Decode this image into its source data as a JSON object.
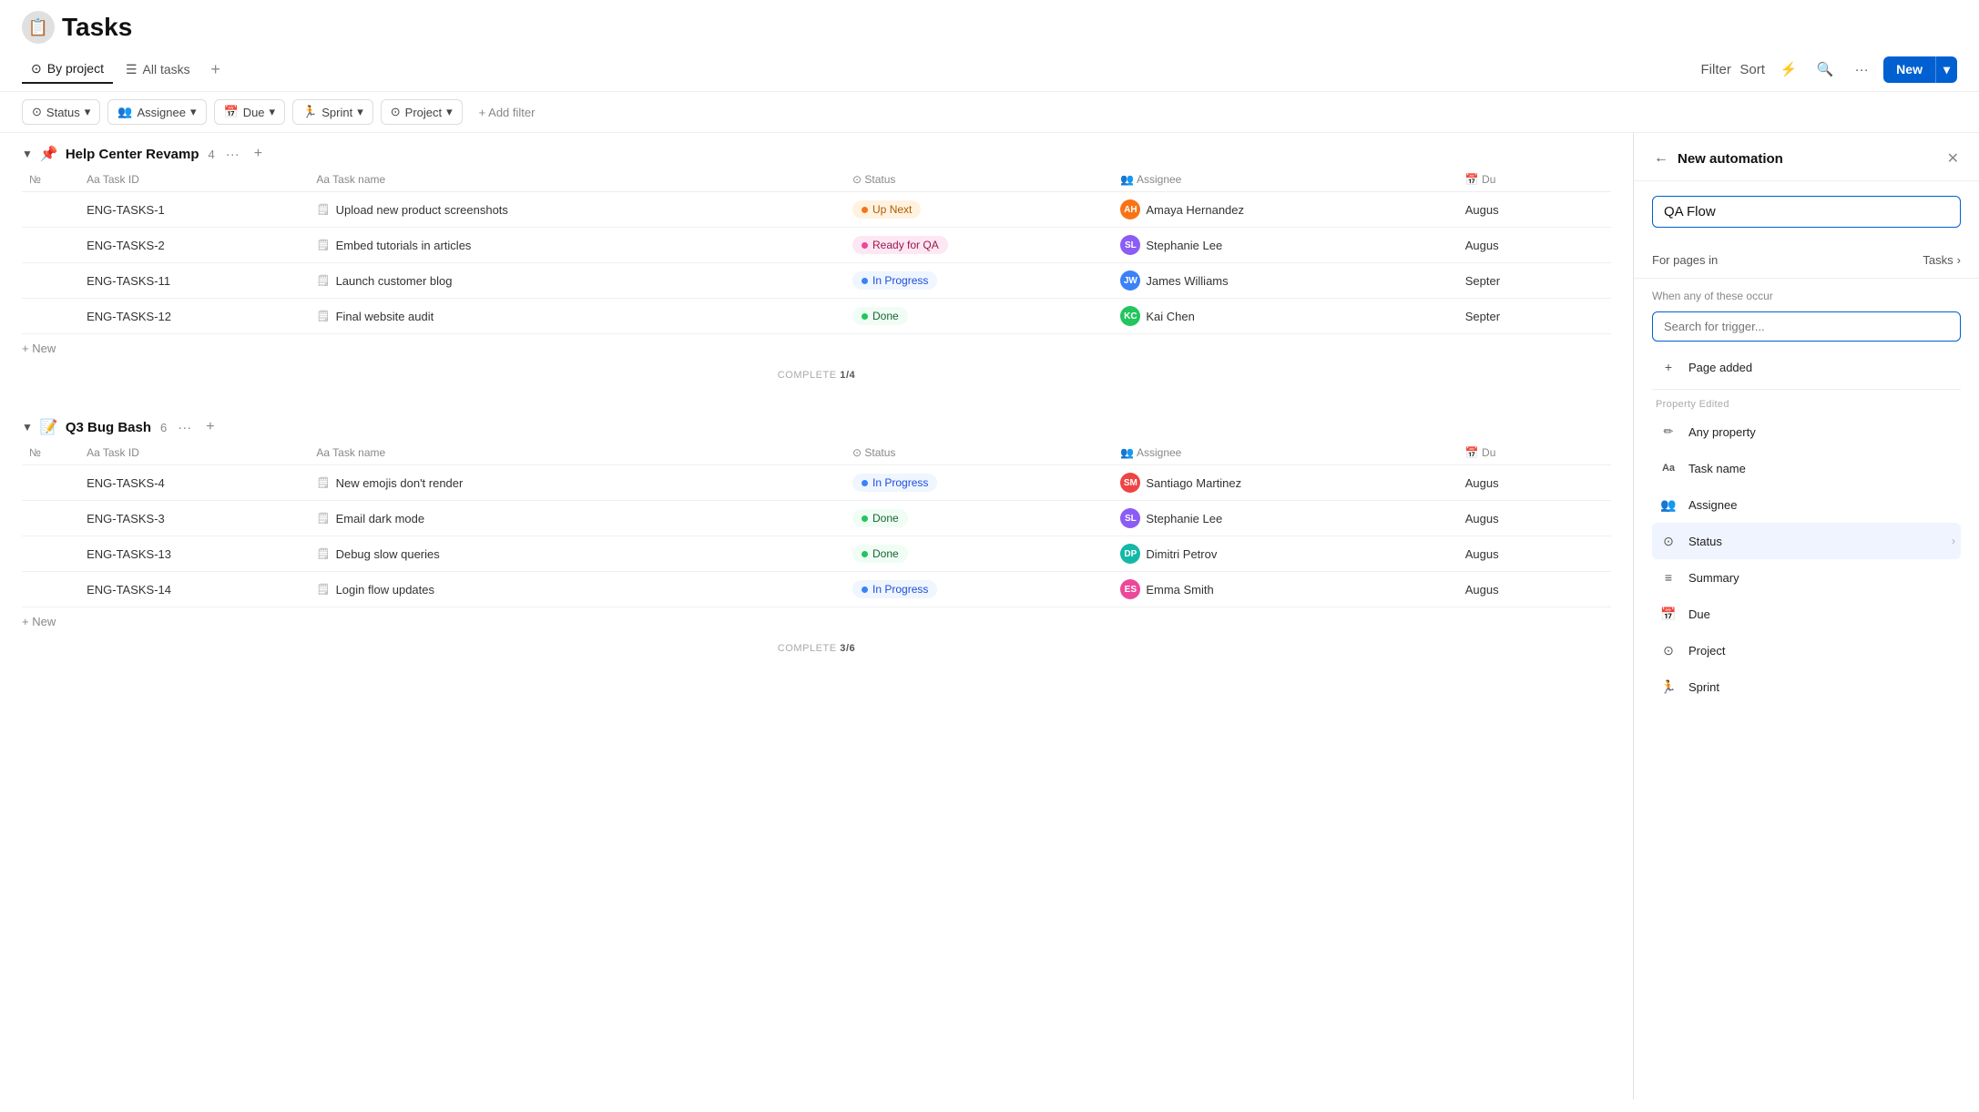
{
  "header": {
    "icon": "📋",
    "title": "Tasks"
  },
  "toolbar": {
    "views": [
      {
        "id": "by-project",
        "label": "By project",
        "icon": "⊙",
        "active": true
      },
      {
        "id": "all-tasks",
        "label": "All tasks",
        "icon": "☰",
        "active": false
      }
    ],
    "add_view_label": "+",
    "filter_label": "Filter",
    "sort_label": "Sort",
    "lightning_label": "⚡",
    "search_label": "🔍",
    "more_label": "···",
    "new_label": "New",
    "new_chevron": "▾"
  },
  "filters": [
    {
      "id": "status",
      "icon": "⊙",
      "label": "Status"
    },
    {
      "id": "assignee",
      "icon": "👥",
      "label": "Assignee"
    },
    {
      "id": "due",
      "icon": "📅",
      "label": "Due"
    },
    {
      "id": "sprint",
      "icon": "🏃",
      "label": "Sprint"
    },
    {
      "id": "project",
      "icon": "⊙",
      "label": "Project"
    }
  ],
  "add_filter_label": "+ Add filter",
  "columns": [
    {
      "id": "num",
      "label": "№"
    },
    {
      "id": "task_id",
      "label": "Task ID"
    },
    {
      "id": "task_name",
      "label": "Task name"
    },
    {
      "id": "status",
      "label": "Status"
    },
    {
      "id": "assignee",
      "label": "Assignee"
    },
    {
      "id": "due",
      "label": "Du"
    }
  ],
  "projects": [
    {
      "id": "help-center",
      "icon": "📌",
      "name": "Help Center Revamp",
      "count": 4,
      "complete": "1/4",
      "tasks": [
        {
          "id": "ENG-TASKS-1",
          "name": "Upload new product screenshots",
          "status": "Up Next",
          "status_class": "status-up-next",
          "assignee": "Amaya Hernandez",
          "assignee_initials": "AH",
          "assignee_color": "av-orange",
          "due": "Augus"
        },
        {
          "id": "ENG-TASKS-2",
          "name": "Embed tutorials in articles",
          "status": "Ready for QA",
          "status_class": "status-ready-qa",
          "assignee": "Stephanie Lee",
          "assignee_initials": "SL",
          "assignee_color": "av-purple",
          "due": "Augus"
        },
        {
          "id": "ENG-TASKS-11",
          "name": "Launch customer blog",
          "status": "In Progress",
          "status_class": "status-in-progress",
          "assignee": "James Williams",
          "assignee_initials": "JW",
          "assignee_color": "av-blue",
          "due": "Septer"
        },
        {
          "id": "ENG-TASKS-12",
          "name": "Final website audit",
          "status": "Done",
          "status_class": "status-done",
          "assignee": "Kai Chen",
          "assignee_initials": "KC",
          "assignee_color": "av-green",
          "due": "Septer"
        }
      ]
    },
    {
      "id": "q3-bug-bash",
      "icon": "📝",
      "name": "Q3 Bug Bash",
      "count": 6,
      "complete": "3/6",
      "tasks": [
        {
          "id": "ENG-TASKS-4",
          "name": "New emojis don't render",
          "status": "In Progress",
          "status_class": "status-in-progress",
          "assignee": "Santiago Martinez",
          "assignee_initials": "SM",
          "assignee_color": "av-red",
          "due": "Augus"
        },
        {
          "id": "ENG-TASKS-3",
          "name": "Email dark mode",
          "status": "Done",
          "status_class": "status-done",
          "assignee": "Stephanie Lee",
          "assignee_initials": "SL",
          "assignee_color": "av-purple",
          "due": "Augus"
        },
        {
          "id": "ENG-TASKS-13",
          "name": "Debug slow queries",
          "status": "Done",
          "status_class": "status-done",
          "assignee": "Dimitri Petrov",
          "assignee_initials": "DP",
          "assignee_color": "av-teal",
          "due": "Augus"
        },
        {
          "id": "ENG-TASKS-14",
          "name": "Login flow updates",
          "status": "In Progress",
          "status_class": "status-in-progress",
          "assignee": "Emma Smith",
          "assignee_initials": "ES",
          "assignee_color": "av-pink",
          "due": "Augus"
        }
      ]
    }
  ],
  "add_task_label": "+ New",
  "panel": {
    "back_label": "←",
    "title": "New automation",
    "close_label": "✕",
    "automation_name": "QA Flow",
    "for_pages_label": "For pages in",
    "for_pages_value": "Tasks",
    "when_label": "When any of these occur",
    "search_placeholder": "Search for trigger...",
    "page_added_label": "Page added",
    "page_added_icon": "+",
    "property_edited_section": "Property edited",
    "trigger_items": [
      {
        "id": "any-property",
        "icon": "✏️",
        "label": "Any property",
        "has_chevron": false
      },
      {
        "id": "task-name",
        "icon": "Aa",
        "label": "Task name",
        "has_chevron": false
      },
      {
        "id": "assignee",
        "icon": "👥",
        "label": "Assignee",
        "has_chevron": false
      },
      {
        "id": "status",
        "icon": "⊙",
        "label": "Status",
        "has_chevron": true,
        "highlighted": true
      },
      {
        "id": "summary",
        "icon": "≡",
        "label": "Summary",
        "has_chevron": false
      },
      {
        "id": "due",
        "icon": "📅",
        "label": "Due",
        "has_chevron": false
      },
      {
        "id": "project",
        "icon": "⊙",
        "label": "Project",
        "has_chevron": false
      },
      {
        "id": "sprint",
        "icon": "🏃",
        "label": "Sprint",
        "has_chevron": false
      }
    ]
  }
}
